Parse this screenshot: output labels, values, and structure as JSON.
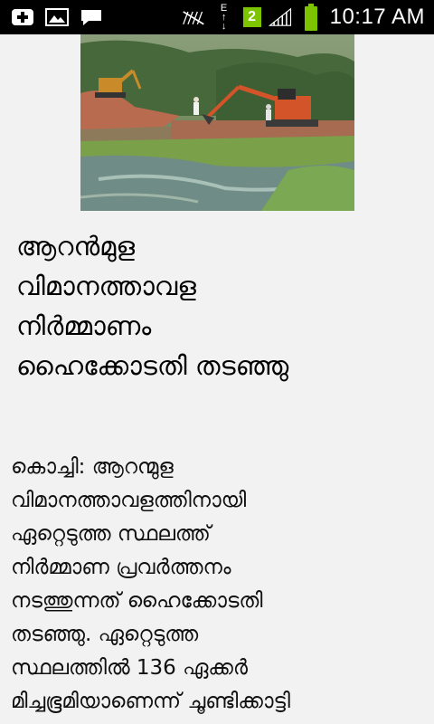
{
  "status_bar": {
    "time": "10:17 AM",
    "network_type": "E",
    "sim_badge": "2",
    "icons": [
      "add-icon",
      "image-icon",
      "message-icon",
      "signal-muted-icon",
      "data-transfer-icon",
      "sim-2-icon",
      "signal-icon",
      "battery-icon"
    ],
    "battery_color": "#7cc400"
  },
  "article": {
    "image_alt": "",
    "headline_lines": [
      "ആറൻമുള",
      "വിമാനത്താവള",
      "നിർമ്മാണം",
      "ഹൈക്കോടതി തടഞ്ഞു"
    ],
    "body_lines": [
      "കൊച്ചി: ആറന്മുള",
      "വിമാനത്താവളത്തിനായി",
      "ഏറ്റെടുത്ത സ്ഥലത്ത്",
      "നിർമ്മാണ പ്രവർത്തനം",
      "നടത്തുന്നത് ഹൈക്കോടതി",
      "തടഞ്ഞു. ഏറ്റെടുത്ത",
      "സ്ഥലത്തിൽ 136 ഏക്കർ",
      "മിച്ചഭൂമിയാണെന്ന് ചൂണ്ടിക്കാട്ടി"
    ]
  }
}
